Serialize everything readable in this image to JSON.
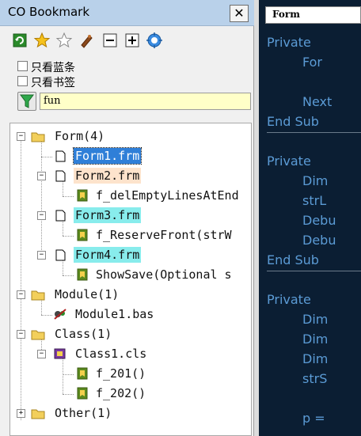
{
  "panel": {
    "title": "CO Bookmark",
    "close_label": "✕",
    "toolbar": {
      "icons": [
        "refresh-icon",
        "star-filled-icon",
        "star-outline-icon",
        "bookmark-icon",
        "collapse-icon",
        "expand-icon",
        "locate-icon"
      ]
    },
    "options": [
      {
        "label": "只看蓝条",
        "checked": false
      },
      {
        "label": "只看书签",
        "checked": false
      }
    ],
    "filter": {
      "value": "fun"
    }
  },
  "tree": {
    "items": [
      {
        "label": "Form(4)"
      },
      {
        "label": "Form1.frm"
      },
      {
        "label": "Form2.frm"
      },
      {
        "label": "f_delEmptyLinesAtEnd"
      },
      {
        "label": "Form3.frm"
      },
      {
        "label": "f_ReserveFront(strW"
      },
      {
        "label": "Form4.frm"
      },
      {
        "label": "ShowSave(Optional s"
      },
      {
        "label": "Module(1)"
      },
      {
        "label": "Module1.bas"
      },
      {
        "label": "Class(1)"
      },
      {
        "label": "Class1.cls"
      },
      {
        "label": "f_201()"
      },
      {
        "label": "f_202()"
      },
      {
        "label": "Other(1)"
      }
    ]
  },
  "editor": {
    "tab_label": "Form",
    "lines": [
      "Private",
      "For",
      "Next",
      "End Sub",
      "Private",
      "Dim",
      "strL",
      "Debu",
      "Debu",
      "End Sub",
      "Private",
      "Dim",
      "Dim",
      "Dim",
      "strS",
      "p ="
    ]
  },
  "colors": {
    "selection": "#2f7fd8",
    "highlight_peach": "#fde3cc",
    "highlight_cyan": "#88ecec",
    "editor_bg": "#0b1e33",
    "keyword": "#5b9bd5"
  }
}
